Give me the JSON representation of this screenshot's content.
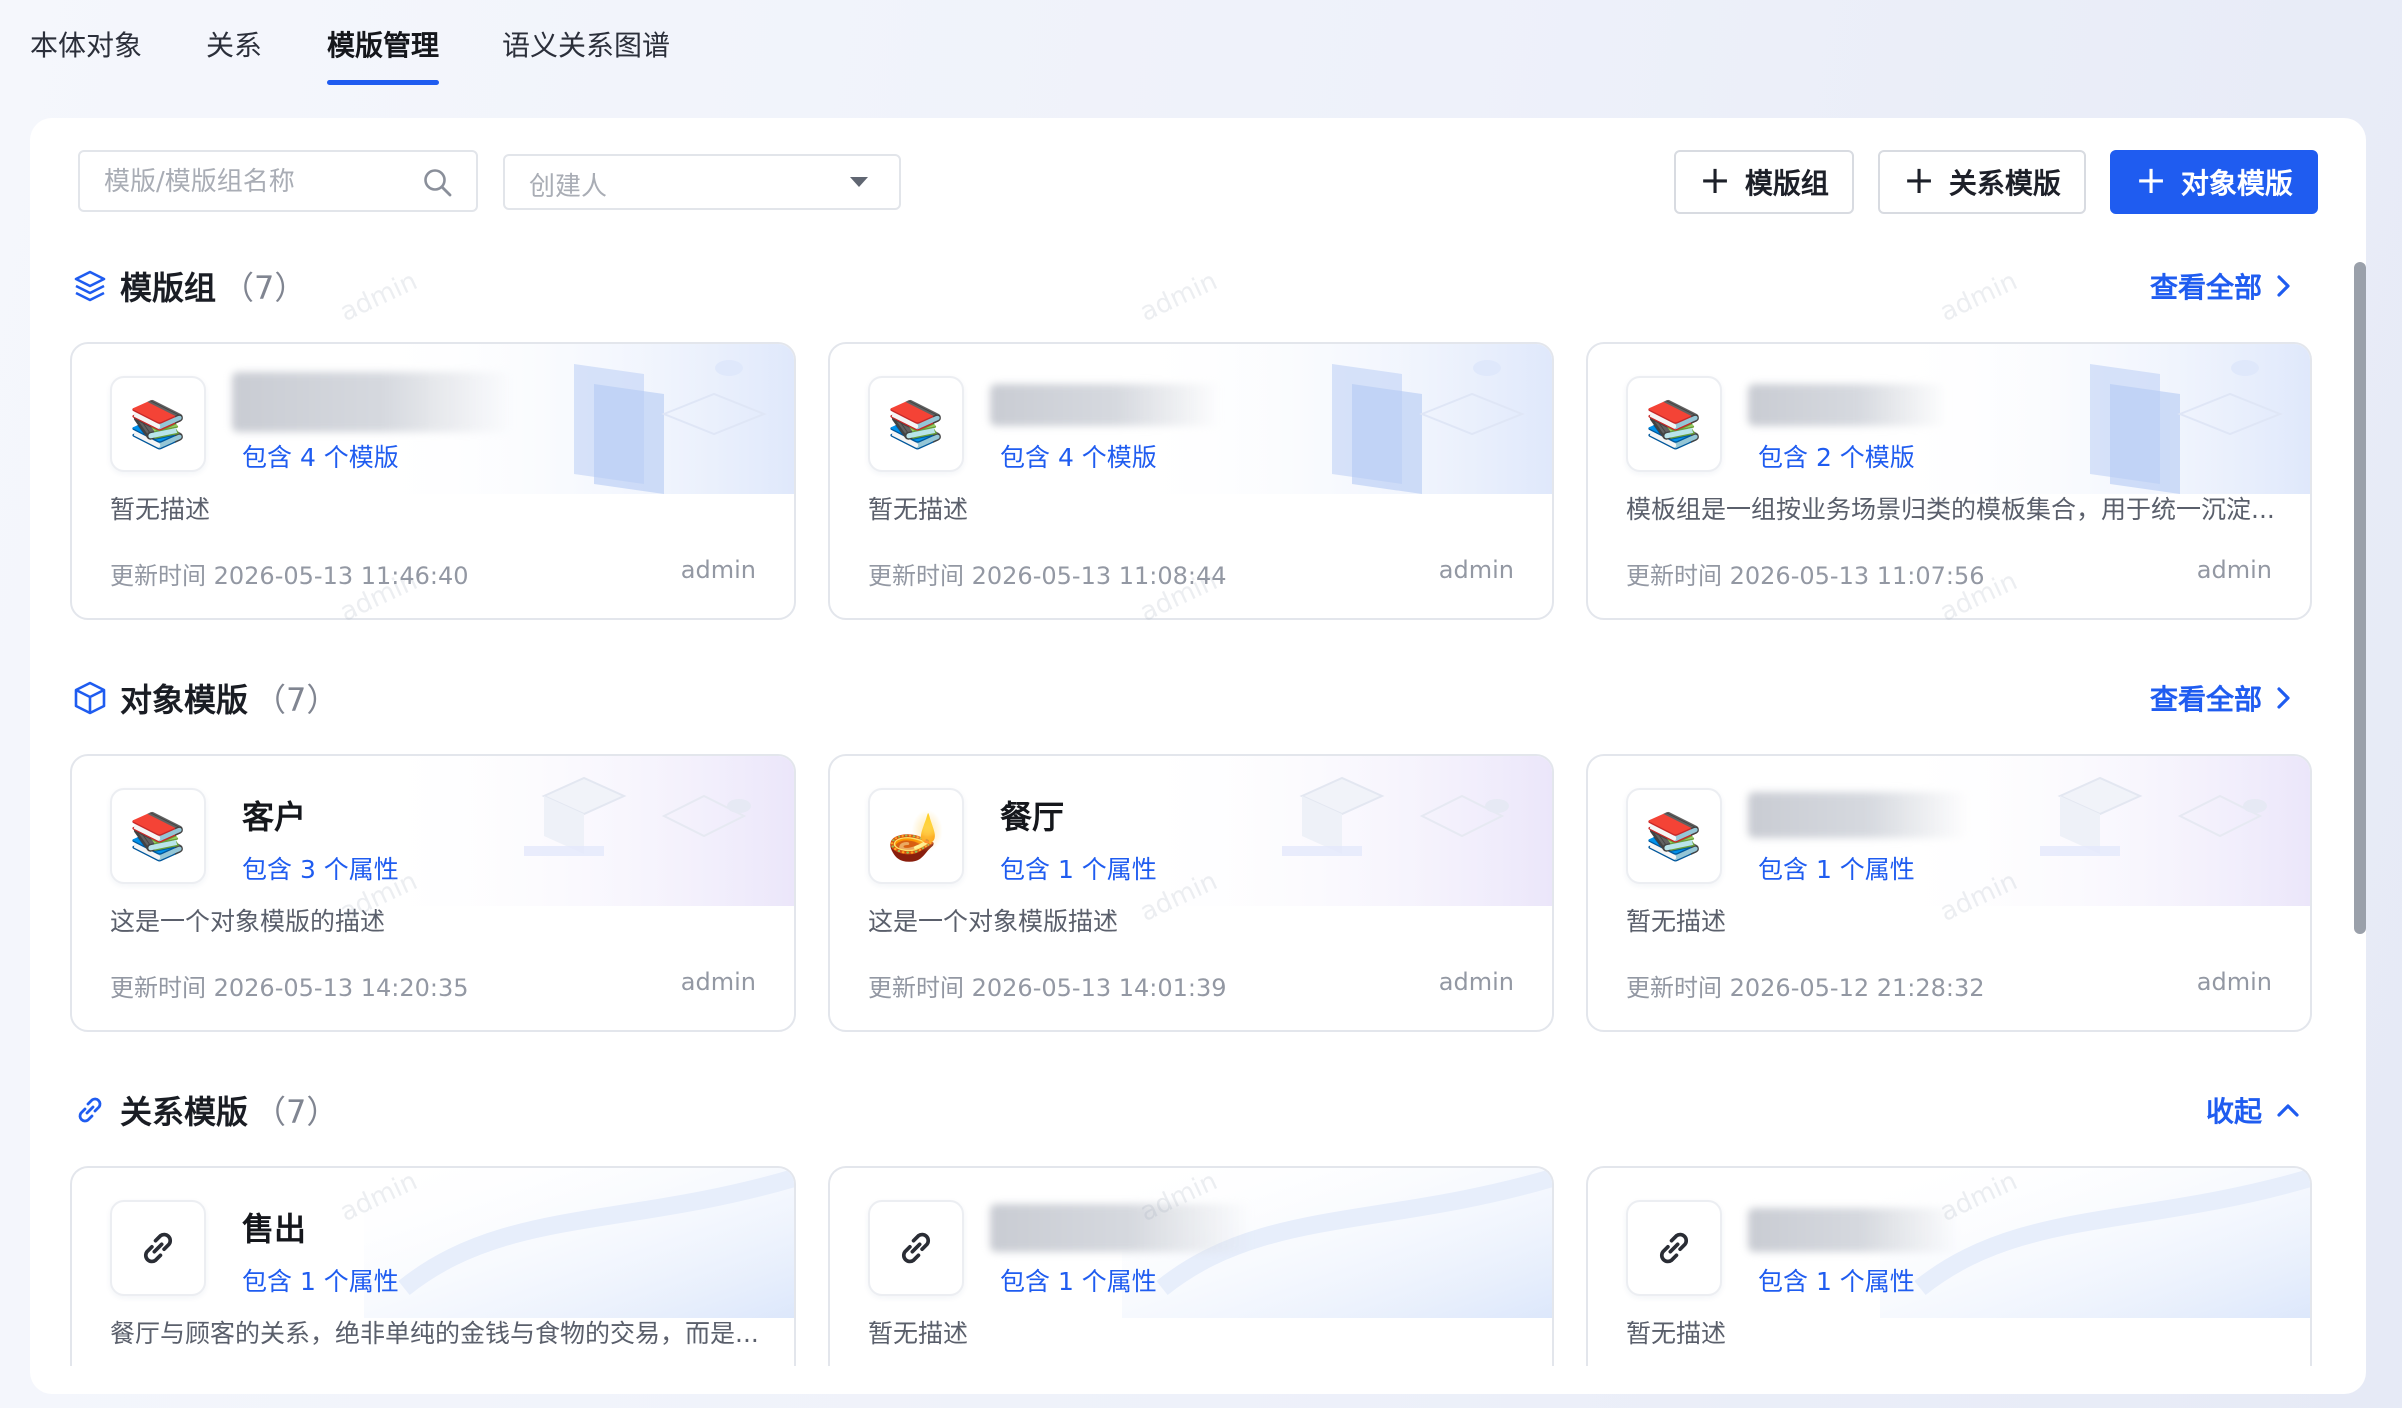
{
  "tabs": [
    {
      "label": "本体对象"
    },
    {
      "label": "关系"
    },
    {
      "label": "模版管理"
    },
    {
      "label": "语义关系图谱"
    }
  ],
  "toolbar": {
    "search_placeholder": "模版/模版组名称",
    "creator_placeholder": "创建人",
    "add_group_label": "模版组",
    "add_relation_label": "关系模版",
    "add_object_label": "对象模版"
  },
  "colors": {
    "accent": "#1f5cf0"
  },
  "watermark_text": "admin",
  "sections": {
    "groups": {
      "title": "模版组",
      "count": "（7）",
      "link": "查看全部",
      "icon": "layers-icon",
      "cards": [
        {
          "title": "",
          "count": "包含 4 个模版",
          "desc": "暂无描述",
          "time": "更新时间 2026-05-13 11:46:40",
          "owner": "admin",
          "icon": "books-icon"
        },
        {
          "title": "",
          "count": "包含 4 个模版",
          "desc": "暂无描述",
          "time": "更新时间 2026-05-13 11:08:44",
          "owner": "admin",
          "icon": "books-icon"
        },
        {
          "title": "",
          "count": "包含 2 个模版",
          "desc": "模板组是一组按业务场景归类的模板集合，用于统一沉淀...",
          "time": "更新时间 2026-05-13 11:07:56",
          "owner": "admin",
          "icon": "books-icon"
        }
      ]
    },
    "objects": {
      "title": "对象模版",
      "count": "（7）",
      "link": "查看全部",
      "icon": "cube-icon",
      "cards": [
        {
          "title": "客户",
          "count": "包含 3 个属性",
          "desc": "这是一个对象模版的描述",
          "time": "更新时间 2026-05-13 14:20:35",
          "owner": "admin",
          "icon": "books-icon"
        },
        {
          "title": "餐厅",
          "count": "包含 1 个属性",
          "desc": "这是一个对象模版描述",
          "time": "更新时间 2026-05-13 14:01:39",
          "owner": "admin",
          "icon": "lamp-icon"
        },
        {
          "title": "",
          "count": "包含 1 个属性",
          "desc": "暂无描述",
          "time": "更新时间 2026-05-12 21:28:32",
          "owner": "admin",
          "icon": "books-icon"
        }
      ]
    },
    "relations": {
      "title": "关系模版",
      "count": "（7）",
      "link": "收起",
      "icon": "link-icon",
      "cards": [
        {
          "title": "售出",
          "count": "包含 1 个属性",
          "desc": "餐厅与顾客的关系，绝非单纯的金钱与食物的交易，而是...",
          "icon": "link-icon"
        },
        {
          "title": "",
          "count": "包含 1 个属性",
          "desc": "暂无描述",
          "icon": "link-icon"
        },
        {
          "title": "",
          "count": "包含 1 个属性",
          "desc": "暂无描述",
          "icon": "link-icon"
        }
      ]
    }
  }
}
